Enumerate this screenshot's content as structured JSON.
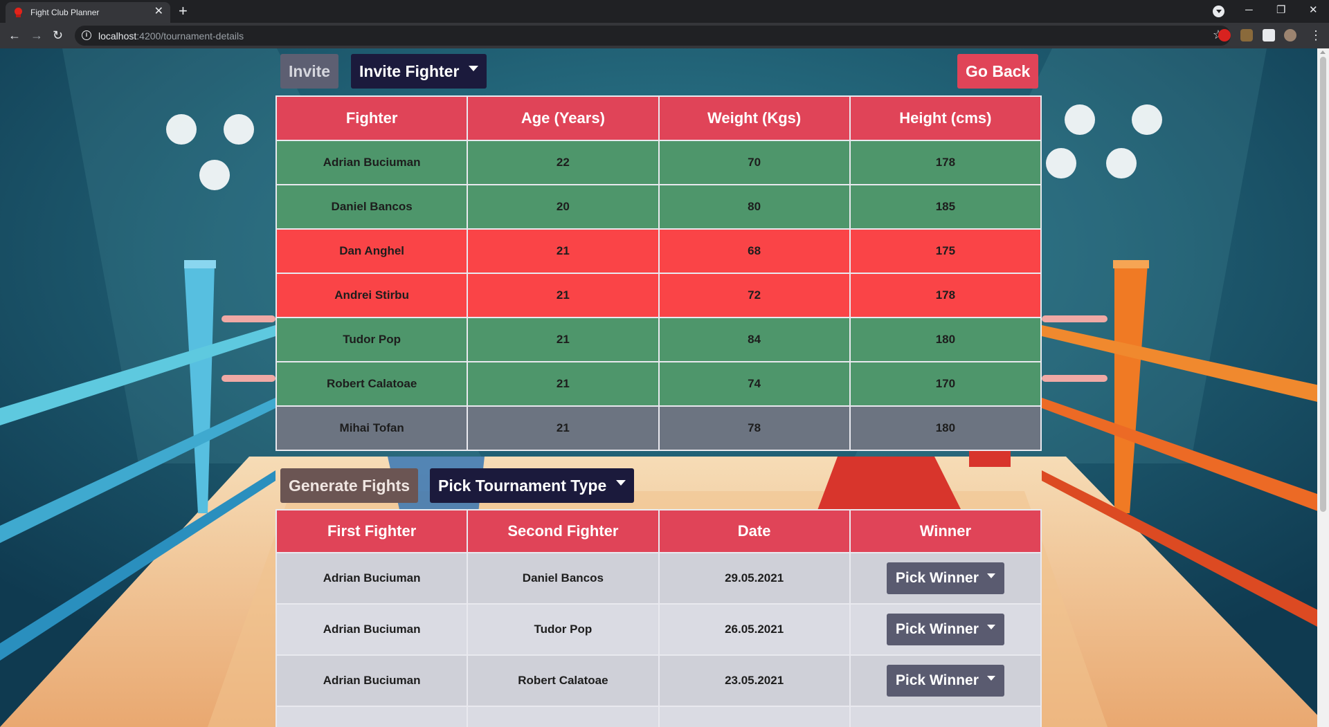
{
  "browser": {
    "tab_title": "Fight Club Planner",
    "url_host": "localhost",
    "url_path": ":4200/tournament-details"
  },
  "page": {
    "invite_label": "Invite",
    "invite_fighter_label": "Invite Fighter",
    "go_back_label": "Go Back",
    "generate_fights_label": "Generate Fights",
    "pick_tournament_type_label": "Pick Tournament Type",
    "fighters_table": {
      "headers": [
        "Fighter",
        "Age (Years)",
        "Weight (Kgs)",
        "Height (cms)"
      ],
      "rows": [
        {
          "name": "Adrian Buciuman",
          "age": "22",
          "weight": "70",
          "height": "178",
          "status": "green"
        },
        {
          "name": "Daniel Bancos",
          "age": "20",
          "weight": "80",
          "height": "185",
          "status": "green"
        },
        {
          "name": "Dan Anghel",
          "age": "21",
          "weight": "68",
          "height": "175",
          "status": "red"
        },
        {
          "name": "Andrei Stirbu",
          "age": "21",
          "weight": "72",
          "height": "178",
          "status": "red"
        },
        {
          "name": "Tudor Pop",
          "age": "21",
          "weight": "84",
          "height": "180",
          "status": "green"
        },
        {
          "name": "Robert Calatoae",
          "age": "21",
          "weight": "74",
          "height": "170",
          "status": "green"
        },
        {
          "name": "Mihai Tofan",
          "age": "21",
          "weight": "78",
          "height": "180",
          "status": "gray"
        }
      ]
    },
    "fights_table": {
      "headers": [
        "First Fighter",
        "Second Fighter",
        "Date",
        "Winner"
      ],
      "pick_winner_label": "Pick Winner",
      "rows": [
        {
          "first": "Adrian Buciuman",
          "second": "Daniel Bancos",
          "date": "29.05.2021"
        },
        {
          "first": "Adrian Buciuman",
          "second": "Tudor Pop",
          "date": "26.05.2021"
        },
        {
          "first": "Adrian Buciuman",
          "second": "Robert Calatoae",
          "date": "23.05.2021"
        }
      ]
    }
  },
  "colors": {
    "header_red": "#e04458",
    "row_green": "#4e966b",
    "row_red": "#fa4447",
    "row_gray": "#6c7481",
    "dark_button": "#1b1a3c"
  }
}
